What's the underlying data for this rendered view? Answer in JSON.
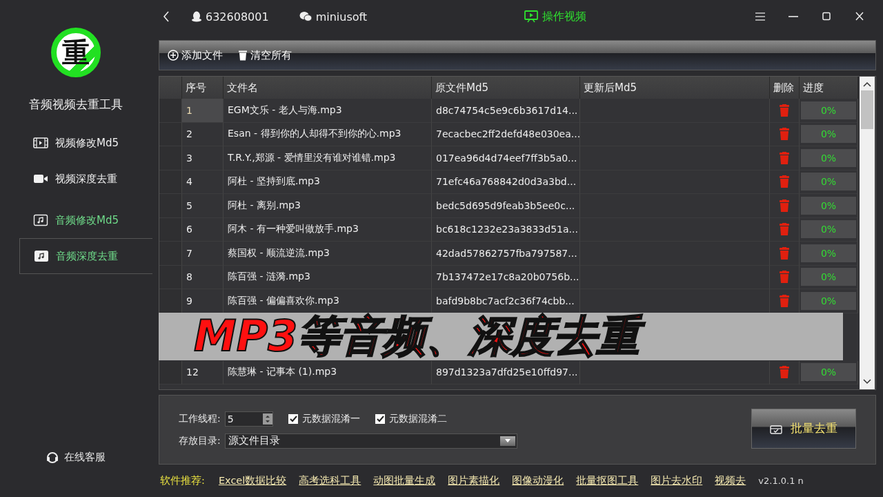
{
  "logo": {
    "text": "重"
  },
  "app_title": "音频视频去重工具",
  "sidebar": {
    "items": [
      {
        "label": "视频修改Md5",
        "kind": "film",
        "highlighted": false,
        "selected": false
      },
      {
        "label": "视频深度去重",
        "kind": "camera",
        "highlighted": false,
        "selected": false
      },
      {
        "label": "音频修改Md5",
        "kind": "music",
        "highlighted": true,
        "selected": false
      },
      {
        "label": "音频深度去重",
        "kind": "music-filled",
        "highlighted": true,
        "selected": true
      }
    ],
    "support": "在线客服"
  },
  "titlebar": {
    "qq": "632608001",
    "wechat": "miniusoft",
    "video_link": "操作视频"
  },
  "toolbar": {
    "buttons": [
      {
        "label": "添加文件",
        "kind": "add"
      },
      {
        "label": "清空所有",
        "kind": "trash"
      }
    ]
  },
  "table": {
    "columns": [
      "序号",
      "文件名",
      "原文件Md5",
      "更新后Md5",
      "删除",
      "进度"
    ],
    "rows": [
      {
        "kind": "file",
        "selected": true,
        "no": "1",
        "name": "EGM文乐 - 老人与海.mp3",
        "md5": "d8c74754c5e9c6b3617d14...",
        "progress": "0%",
        "level": 0
      },
      {
        "kind": "file",
        "selected": false,
        "no": "2",
        "name": "Esan - 得到你的人却得不到你的心.mp3",
        "md5": "7ecacbec2ff2defd48e030ea...",
        "progress": "0%",
        "level": 0
      },
      {
        "kind": "file",
        "selected": false,
        "no": "3",
        "name": "T.R.Y.,郑源 - 爱情里没有谁对谁错.mp3",
        "md5": "017ea96d4d74eef7ff3b5a0...",
        "progress": "0%",
        "level": 0
      },
      {
        "kind": "file",
        "selected": false,
        "no": "4",
        "name": "阿杜 - 坚持到底.mp3",
        "md5": "71efc46a768842d0d3a3bd...",
        "progress": "0%",
        "level": 0
      },
      {
        "kind": "file",
        "selected": false,
        "no": "5",
        "name": "阿杜 - 离别.mp3",
        "md5": "bedc5d695d9feab3b5ee0c...",
        "progress": "0%",
        "level": 0
      },
      {
        "kind": "file",
        "selected": false,
        "no": "6",
        "name": "阿木 - 有一种爱叫做放手.mp3",
        "md5": "bc618c1232e23a3833d51a...",
        "progress": "0%",
        "level": 0
      },
      {
        "kind": "file",
        "selected": false,
        "no": "7",
        "name": "蔡国权 - 顺流逆流.mp3",
        "md5": "42dad57862757fba797587...",
        "progress": "0%",
        "level": 0
      },
      {
        "kind": "file",
        "selected": false,
        "no": "8",
        "name": "陈百强 - 涟漪.mp3",
        "md5": "7b137472e17c8a20b0756b...",
        "progress": "0%",
        "level": 0
      },
      {
        "kind": "file",
        "selected": false,
        "no": "9",
        "name": "陈百强 - 偏偏喜欢你.mp3",
        "md5": "bafd9b8bc7acf2c36f74cbb...",
        "progress": "0%",
        "level": 0
      },
      {
        "kind": "covered"
      },
      {
        "kind": "covered"
      },
      {
        "kind": "file",
        "selected": false,
        "no": "12",
        "name": "陈慧琳 - 记事本 (1).mp3",
        "md5": "897d1323a7dfd25e10ffd97...",
        "progress": "0%",
        "level": 0
      }
    ]
  },
  "banner": {
    "text": "MP3等音频、深度去重"
  },
  "options": {
    "threads_label": "工作线程:",
    "threads": "5",
    "checkboxes": [
      {
        "label": "元数据混淆一",
        "checked": true
      },
      {
        "label": "元数据混淆二",
        "checked": true
      }
    ],
    "dir_label": "存放目录:",
    "dir": "源文件目录",
    "run_button": "批量去重"
  },
  "footer": {
    "label": "软件推荐:",
    "links": [
      "Excel数据比较",
      "高考选科工具",
      "动图批量生成",
      "图片素描化",
      "图像动漫化",
      "批量抠图工具",
      "图片去水印",
      "视频去"
    ],
    "version": "v2.1.0.1 n"
  }
}
